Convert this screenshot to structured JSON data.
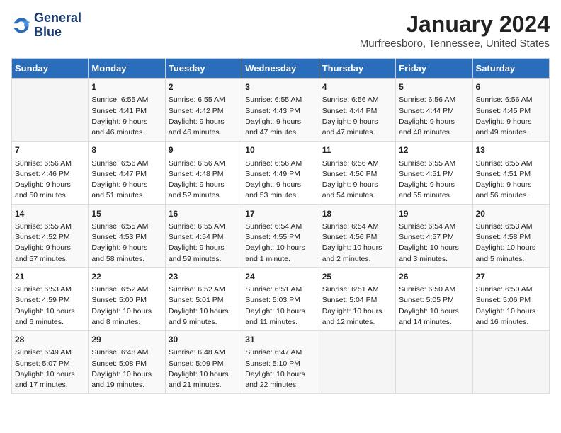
{
  "logo": {
    "line1": "General",
    "line2": "Blue"
  },
  "title": "January 2024",
  "subtitle": "Murfreesboro, Tennessee, United States",
  "days_header": [
    "Sunday",
    "Monday",
    "Tuesday",
    "Wednesday",
    "Thursday",
    "Friday",
    "Saturday"
  ],
  "weeks": [
    [
      {
        "day": "",
        "data": ""
      },
      {
        "day": "1",
        "data": "Sunrise: 6:55 AM\nSunset: 4:41 PM\nDaylight: 9 hours\nand 46 minutes."
      },
      {
        "day": "2",
        "data": "Sunrise: 6:55 AM\nSunset: 4:42 PM\nDaylight: 9 hours\nand 46 minutes."
      },
      {
        "day": "3",
        "data": "Sunrise: 6:55 AM\nSunset: 4:43 PM\nDaylight: 9 hours\nand 47 minutes."
      },
      {
        "day": "4",
        "data": "Sunrise: 6:56 AM\nSunset: 4:44 PM\nDaylight: 9 hours\nand 47 minutes."
      },
      {
        "day": "5",
        "data": "Sunrise: 6:56 AM\nSunset: 4:44 PM\nDaylight: 9 hours\nand 48 minutes."
      },
      {
        "day": "6",
        "data": "Sunrise: 6:56 AM\nSunset: 4:45 PM\nDaylight: 9 hours\nand 49 minutes."
      }
    ],
    [
      {
        "day": "7",
        "data": "Sunrise: 6:56 AM\nSunset: 4:46 PM\nDaylight: 9 hours\nand 50 minutes."
      },
      {
        "day": "8",
        "data": "Sunrise: 6:56 AM\nSunset: 4:47 PM\nDaylight: 9 hours\nand 51 minutes."
      },
      {
        "day": "9",
        "data": "Sunrise: 6:56 AM\nSunset: 4:48 PM\nDaylight: 9 hours\nand 52 minutes."
      },
      {
        "day": "10",
        "data": "Sunrise: 6:56 AM\nSunset: 4:49 PM\nDaylight: 9 hours\nand 53 minutes."
      },
      {
        "day": "11",
        "data": "Sunrise: 6:56 AM\nSunset: 4:50 PM\nDaylight: 9 hours\nand 54 minutes."
      },
      {
        "day": "12",
        "data": "Sunrise: 6:55 AM\nSunset: 4:51 PM\nDaylight: 9 hours\nand 55 minutes."
      },
      {
        "day": "13",
        "data": "Sunrise: 6:55 AM\nSunset: 4:51 PM\nDaylight: 9 hours\nand 56 minutes."
      }
    ],
    [
      {
        "day": "14",
        "data": "Sunrise: 6:55 AM\nSunset: 4:52 PM\nDaylight: 9 hours\nand 57 minutes."
      },
      {
        "day": "15",
        "data": "Sunrise: 6:55 AM\nSunset: 4:53 PM\nDaylight: 9 hours\nand 58 minutes."
      },
      {
        "day": "16",
        "data": "Sunrise: 6:55 AM\nSunset: 4:54 PM\nDaylight: 9 hours\nand 59 minutes."
      },
      {
        "day": "17",
        "data": "Sunrise: 6:54 AM\nSunset: 4:55 PM\nDaylight: 10 hours\nand 1 minute."
      },
      {
        "day": "18",
        "data": "Sunrise: 6:54 AM\nSunset: 4:56 PM\nDaylight: 10 hours\nand 2 minutes."
      },
      {
        "day": "19",
        "data": "Sunrise: 6:54 AM\nSunset: 4:57 PM\nDaylight: 10 hours\nand 3 minutes."
      },
      {
        "day": "20",
        "data": "Sunrise: 6:53 AM\nSunset: 4:58 PM\nDaylight: 10 hours\nand 5 minutes."
      }
    ],
    [
      {
        "day": "21",
        "data": "Sunrise: 6:53 AM\nSunset: 4:59 PM\nDaylight: 10 hours\nand 6 minutes."
      },
      {
        "day": "22",
        "data": "Sunrise: 6:52 AM\nSunset: 5:00 PM\nDaylight: 10 hours\nand 8 minutes."
      },
      {
        "day": "23",
        "data": "Sunrise: 6:52 AM\nSunset: 5:01 PM\nDaylight: 10 hours\nand 9 minutes."
      },
      {
        "day": "24",
        "data": "Sunrise: 6:51 AM\nSunset: 5:03 PM\nDaylight: 10 hours\nand 11 minutes."
      },
      {
        "day": "25",
        "data": "Sunrise: 6:51 AM\nSunset: 5:04 PM\nDaylight: 10 hours\nand 12 minutes."
      },
      {
        "day": "26",
        "data": "Sunrise: 6:50 AM\nSunset: 5:05 PM\nDaylight: 10 hours\nand 14 minutes."
      },
      {
        "day": "27",
        "data": "Sunrise: 6:50 AM\nSunset: 5:06 PM\nDaylight: 10 hours\nand 16 minutes."
      }
    ],
    [
      {
        "day": "28",
        "data": "Sunrise: 6:49 AM\nSunset: 5:07 PM\nDaylight: 10 hours\nand 17 minutes."
      },
      {
        "day": "29",
        "data": "Sunrise: 6:48 AM\nSunset: 5:08 PM\nDaylight: 10 hours\nand 19 minutes."
      },
      {
        "day": "30",
        "data": "Sunrise: 6:48 AM\nSunset: 5:09 PM\nDaylight: 10 hours\nand 21 minutes."
      },
      {
        "day": "31",
        "data": "Sunrise: 6:47 AM\nSunset: 5:10 PM\nDaylight: 10 hours\nand 22 minutes."
      },
      {
        "day": "",
        "data": ""
      },
      {
        "day": "",
        "data": ""
      },
      {
        "day": "",
        "data": ""
      }
    ]
  ]
}
